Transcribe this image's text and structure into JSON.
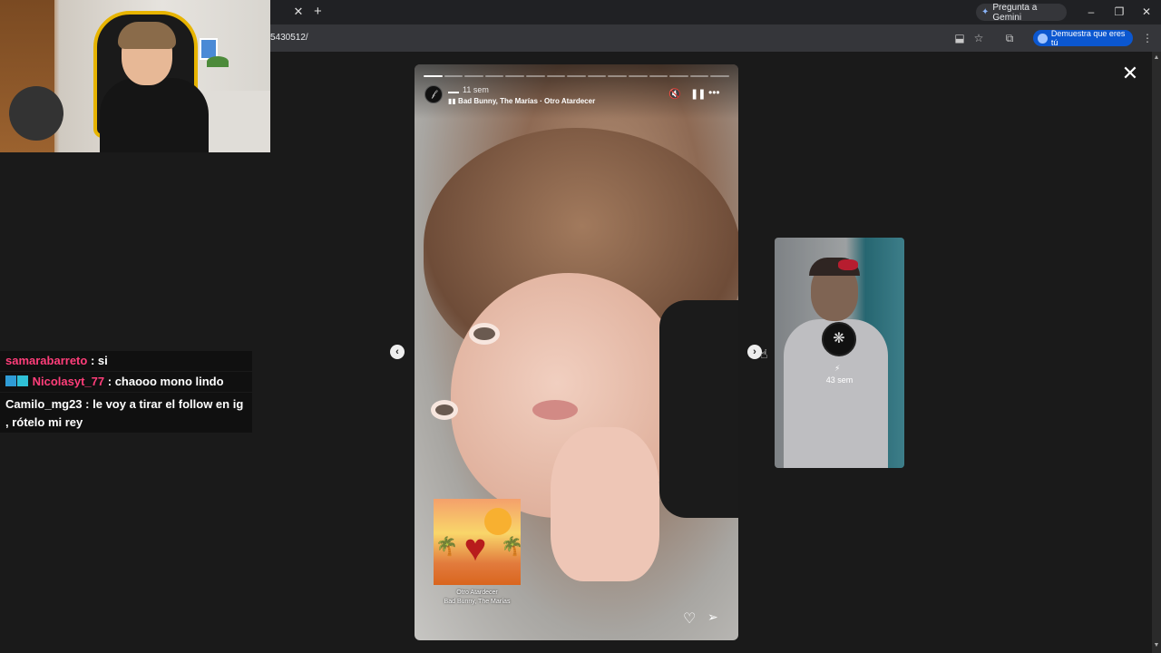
{
  "browser": {
    "tab_close": "✕",
    "new_tab": "+",
    "gemini_label": "Pregunta a Gemini",
    "url": "5430512/",
    "profile_label": "Demuestra que eres tú",
    "window_minimize": "–",
    "window_restore": "❐",
    "window_close": "✕"
  },
  "chat": {
    "messages": [
      {
        "user": "samarabarreto",
        "text": ": si"
      },
      {
        "user": "Nicolasyt_77",
        "text": ": chaooo mono lindo"
      },
      {
        "user": "Camilo_mg23",
        "text": ": le voy a tirar el follow en ig , rótelo mi rey"
      }
    ]
  },
  "story": {
    "time_ago": "11 sem",
    "music": "Bad Bunny, The Marías · Otro Atardecer",
    "music_icon": "▮▮",
    "sticker_title": "Otro Atardecer",
    "sticker_artist": "Bad Bunny, The Marías",
    "progress_total": 15,
    "progress_done": 1
  },
  "next_story": {
    "time_ago": "43 sem"
  },
  "icons": {
    "close": "✕",
    "prev": "‹",
    "next": "›",
    "mute": "🔇",
    "pause": "❚❚",
    "more": "•••",
    "heart": "♡",
    "share": "➢",
    "bolt": "⚡"
  }
}
